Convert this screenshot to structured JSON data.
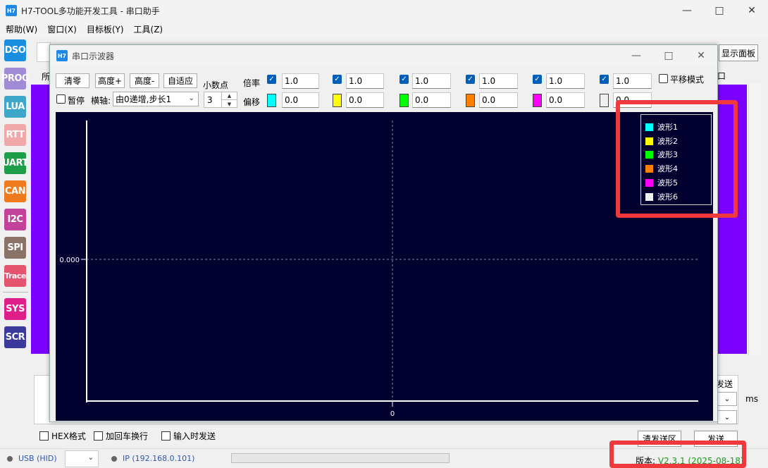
{
  "app": {
    "title": "H7-TOOL多功能开发工具 - 串口助手",
    "icon_text": "H7",
    "window_buttons": [
      "minimize-icon",
      "maximize-icon",
      "close-icon"
    ]
  },
  "menu": [
    "帮助(W)",
    "窗口(X)",
    "目标板(Y)",
    "工具(Z)"
  ],
  "sidebar": [
    {
      "label": "DSO",
      "color": "#1a8fe0"
    },
    {
      "label": "PROG",
      "color": "#a08bd6"
    },
    {
      "label": "LUA",
      "color": "#3ea6c8"
    },
    {
      "label": "RTT",
      "color": "#f0a8a8"
    },
    {
      "label": "UART",
      "color": "#1f9e4a"
    },
    {
      "label": "CAN",
      "color": "#f07a1e"
    },
    {
      "label": "I2C",
      "color": "#c2449a"
    },
    {
      "label": "SPI",
      "color": "#8a7268"
    },
    {
      "label": "Trace",
      "color": "#e5546e"
    },
    {
      "label": "SYS",
      "color": "#e01e8a"
    },
    {
      "label": "SCR",
      "color": "#3a3a9a"
    }
  ],
  "background": {
    "show_panel": "显示面板",
    "frag_tab": "所",
    "frag_tab2": "口",
    "frag_send": "发送",
    "frag_ms": "ms",
    "hex_format": "HEX格式",
    "add_crlf": "加回车换行",
    "send_on_input": "输入时发送",
    "clear_send": "清发送区",
    "send": "发送"
  },
  "status": {
    "usb": "USB (HID)",
    "ip": "IP (192.168.0.101)",
    "version_label": "版本:",
    "version": "V2.3.1 (2025-08-18)"
  },
  "scope": {
    "title": "串口示波器",
    "icon_text": "H7",
    "btn_clear": "清零",
    "btn_height_up": "高度+",
    "btn_height_down": "高度-",
    "btn_auto": "自适应",
    "decimal_label": "小数点",
    "decimal_value": "3",
    "scale_label": "倍率",
    "offset_label": "偏移",
    "pause_label": "暂停",
    "xaxis_label": "横轴:",
    "xaxis_value": "由0递增,步长1",
    "pan_mode": "平移模式",
    "channels": [
      {
        "name": "波形1",
        "color": "#00ffff",
        "scale": "1.0",
        "offset": "0.0",
        "enabled": true
      },
      {
        "name": "波形2",
        "color": "#ffff00",
        "scale": "1.0",
        "offset": "0.0",
        "enabled": true
      },
      {
        "name": "波形3",
        "color": "#00ff00",
        "scale": "1.0",
        "offset": "0.0",
        "enabled": true
      },
      {
        "name": "波形4",
        "color": "#ff7f00",
        "scale": "1.0",
        "offset": "0.0",
        "enabled": true
      },
      {
        "name": "波形5",
        "color": "#ff00ff",
        "scale": "1.0",
        "offset": "0.0",
        "enabled": true
      },
      {
        "name": "波形6",
        "color": "#f0f0f0",
        "scale": "1.0",
        "offset": "0.0",
        "enabled": true
      }
    ],
    "plot": {
      "background": "#02002e",
      "y_tick": "0.000",
      "x_tick": "0"
    }
  }
}
